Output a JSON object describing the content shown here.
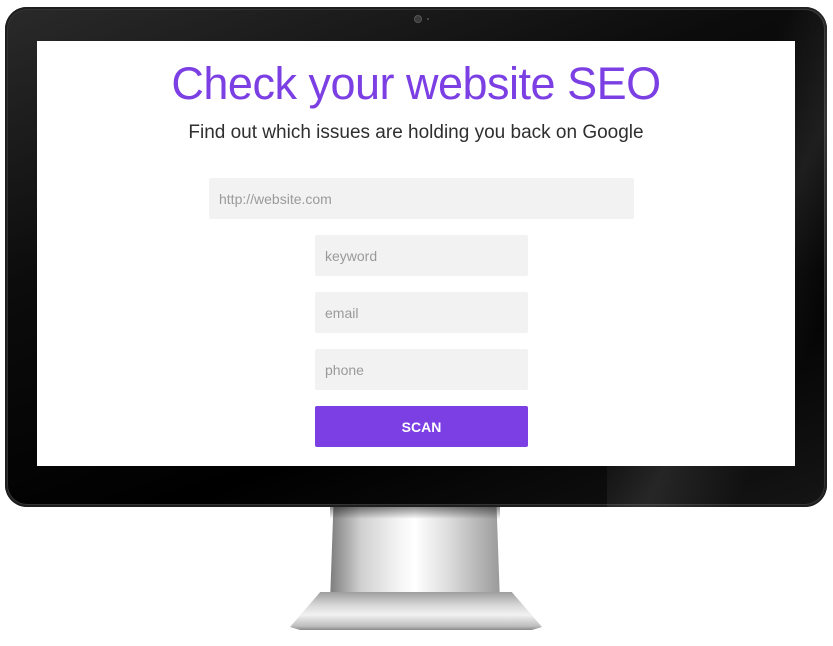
{
  "headline": "Check your website SEO",
  "subheadline": "Find out which issues are holding you back on Google",
  "form": {
    "website_placeholder": "http://website.com",
    "keyword_placeholder": "keyword",
    "email_placeholder": "email",
    "phone_placeholder": "phone",
    "scan_label": "SCAN"
  },
  "colors": {
    "accent": "#7b3fe4",
    "field_background": "#f2f2f2",
    "bezel": "#0c0c0c"
  }
}
